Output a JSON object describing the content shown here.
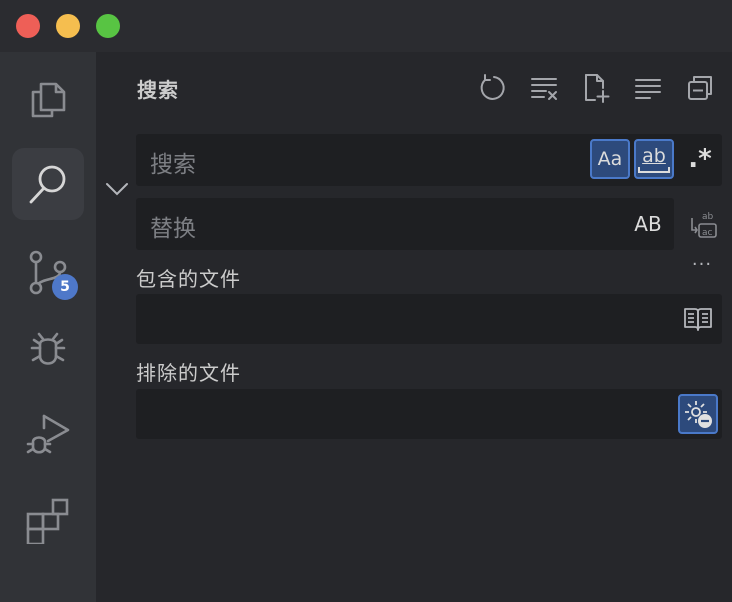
{
  "window": {
    "controls": [
      "close",
      "minimize",
      "maximize"
    ]
  },
  "activity_bar": {
    "items": [
      {
        "name": "explorer",
        "icon": "files-icon"
      },
      {
        "name": "search",
        "icon": "search-icon",
        "active": true
      },
      {
        "name": "source-control",
        "icon": "source-control-icon",
        "badge": "5"
      },
      {
        "name": "debug",
        "icon": "bug-icon"
      },
      {
        "name": "run-debug",
        "icon": "run-debug-icon"
      },
      {
        "name": "extensions",
        "icon": "extensions-icon"
      }
    ]
  },
  "search_panel": {
    "title": "搜索",
    "toolbar": [
      "refresh-icon",
      "clear-results-icon",
      "new-search-editor-icon",
      "collapse-all-icon",
      "view-as-tree-icon"
    ],
    "search_input": {
      "placeholder": "搜索",
      "value": ""
    },
    "search_options": {
      "match_case": "Aa",
      "whole_word": "ab",
      "regex": ".*"
    },
    "replace_input": {
      "placeholder": "替换",
      "value": ""
    },
    "replace_options": {
      "preserve_case": "AB"
    },
    "more": "···",
    "include_label": "包含的文件",
    "include_input": {
      "value": ""
    },
    "exclude_label": "排除的文件",
    "exclude_input": {
      "value": ""
    }
  },
  "colors": {
    "accent": "#4a79c9",
    "accent_bg": "#2d4a7c",
    "badge": "#4e78c9"
  }
}
